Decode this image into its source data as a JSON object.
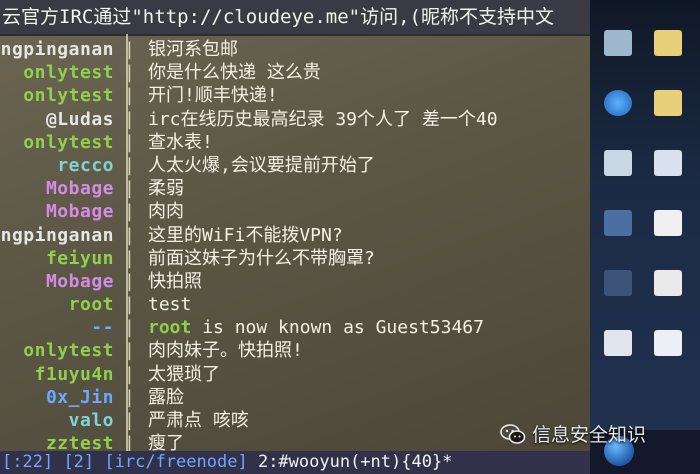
{
  "topic": "云官方IRC通过\"http://cloudeye.me\"访问,(昵称不支持中文",
  "log": [
    {
      "nick": "ngpinganan",
      "color": "#e6e6e6",
      "msg": "银河系包邮"
    },
    {
      "nick": "onlytest",
      "color": "#8fd14b",
      "msg": "你是什么快递 这么贵"
    },
    {
      "nick": "onlytest",
      "color": "#8fd14b",
      "msg": "开门!顺丰快递!"
    },
    {
      "nick": "@Ludas",
      "color": "#e6e6e6",
      "msg": "irc在线历史最高纪录 39个人了 差一个40"
    },
    {
      "nick": "onlytest",
      "color": "#8fd14b",
      "msg": "查水表!"
    },
    {
      "nick": "recco",
      "color": "#7fd4d4",
      "msg": "人太火爆,会议要提前开始了"
    },
    {
      "nick": "Mobage",
      "color": "#d58be6",
      "msg": "柔弱"
    },
    {
      "nick": "Mobage",
      "color": "#d58be6",
      "msg": "肉肉"
    },
    {
      "nick": "ngpinganan",
      "color": "#e6e6e6",
      "msg": "这里的WiFi不能拨VPN?"
    },
    {
      "nick": "feiyun",
      "color": "#8fd14b",
      "msg": "前面这妹子为什么不带胸罩?"
    },
    {
      "nick": "Mobage",
      "color": "#d58be6",
      "msg": "快拍照"
    },
    {
      "nick": "root",
      "color": "#8fd14b",
      "msg": "test"
    },
    {
      "nick": "--",
      "color": "#6fa6ff",
      "msg_hl": "root",
      "msg": " is now known as Guest53467"
    },
    {
      "nick": "onlytest",
      "color": "#8fd14b",
      "msg": "肉肉妹子。快拍照!"
    },
    {
      "nick": "f1uyu4n",
      "color": "#8fd14b",
      "msg": "太猥琐了"
    },
    {
      "nick": "0x_Jin",
      "color": "#6fa6ff",
      "msg": "露脸"
    },
    {
      "nick": "valo",
      "color": "#7fd4d4",
      "msg": "严肃点 咳咳"
    },
    {
      "nick": "zztest",
      "color": "#8fd14b",
      "msg": "瘦了"
    }
  ],
  "statusbar": {
    "time": "[:22]",
    "win_num": "[2]",
    "network": "[irc/freenode]",
    "channel": "2:#wooyun(+nt){40}*"
  },
  "watermark": "信息安全知识"
}
